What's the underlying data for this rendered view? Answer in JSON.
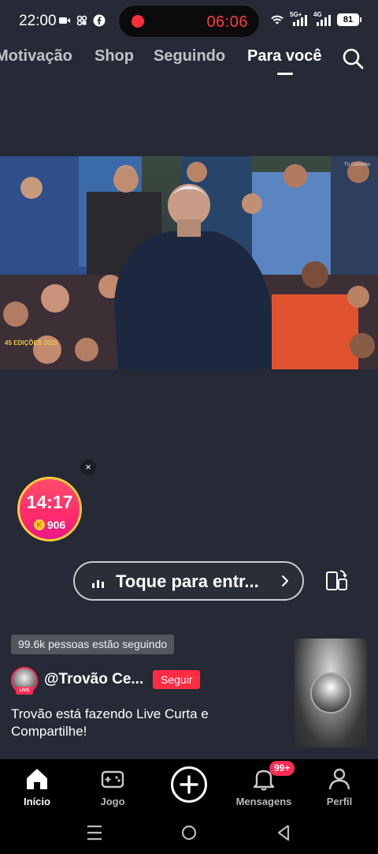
{
  "status_bar": {
    "time": "22:00",
    "recording_time": "06:06",
    "network_5g": "5G+",
    "network_4g": "4G",
    "battery": "81"
  },
  "top_nav": {
    "tabs": [
      "Motivação",
      "Shop",
      "Seguindo",
      "Para você"
    ],
    "active_tab": "Para você"
  },
  "video": {
    "watermark_left": "45 EDIÇÕES 2025",
    "watermark_right": "TV Globinho"
  },
  "timer": {
    "time": "14:17",
    "coins": "906",
    "close": "×"
  },
  "live_entry": {
    "label": "Toque para entr..."
  },
  "stream": {
    "followers_text": "99.6k pessoas estão seguindo",
    "creator_name": "@Trovão Ce...",
    "follow_label": "Seguir",
    "live_badge": "LIVE",
    "description": "Trovão está fazendo Live Curta e Compartilhe!"
  },
  "bottom_nav": {
    "items": [
      {
        "label": "Início"
      },
      {
        "label": "Jogo"
      },
      {
        "label": "Mensagens"
      },
      {
        "label": "Perfil"
      }
    ],
    "notification_count": "99+"
  },
  "colors": {
    "background": "#262a36",
    "accent_red": "#ff2c43",
    "timer_gold": "#ffcc3d"
  }
}
